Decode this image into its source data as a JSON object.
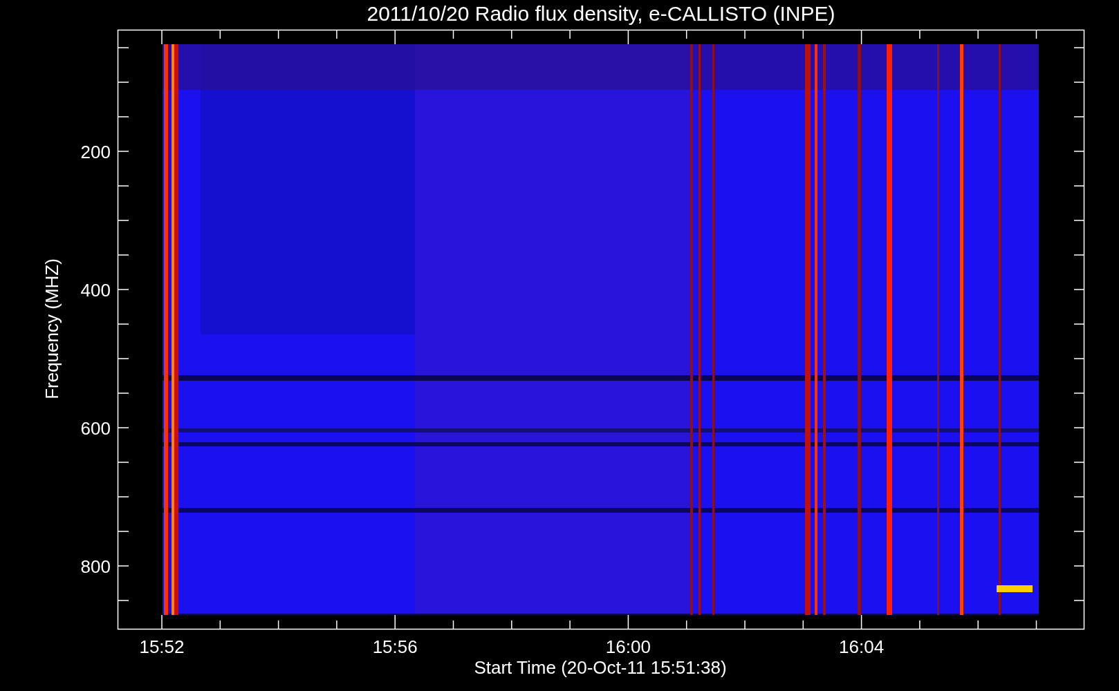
{
  "title": "2011/10/20  Radio flux density, e-CALLISTO (INPE)",
  "y_axis": {
    "label": "Frequency (MHZ)",
    "ticks": [
      "200",
      "400",
      "600",
      "800"
    ]
  },
  "x_axis": {
    "label": "Start Time (20-Oct-11 15:51:38)",
    "ticks": [
      "15:52",
      "15:56",
      "16:00",
      "16:04"
    ]
  }
}
